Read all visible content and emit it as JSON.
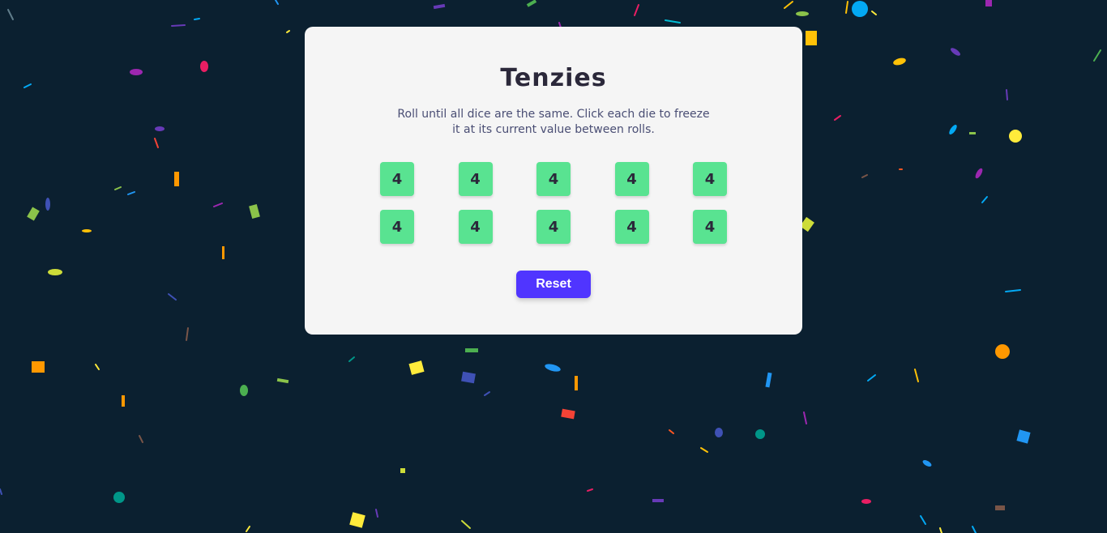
{
  "game": {
    "title": "Tenzies",
    "instructions": "Roll until all dice are the same. Click each die to freeze it at its current value between rolls.",
    "dice": [
      "4",
      "4",
      "4",
      "4",
      "4",
      "4",
      "4",
      "4",
      "4",
      "4"
    ],
    "reset_label": "Reset"
  },
  "colors": {
    "background": "#0b2030",
    "card": "#f5f5f5",
    "die_held": "#59e391",
    "button": "#5035ff",
    "title": "#2b283a",
    "instructions": "#4a4e74"
  }
}
